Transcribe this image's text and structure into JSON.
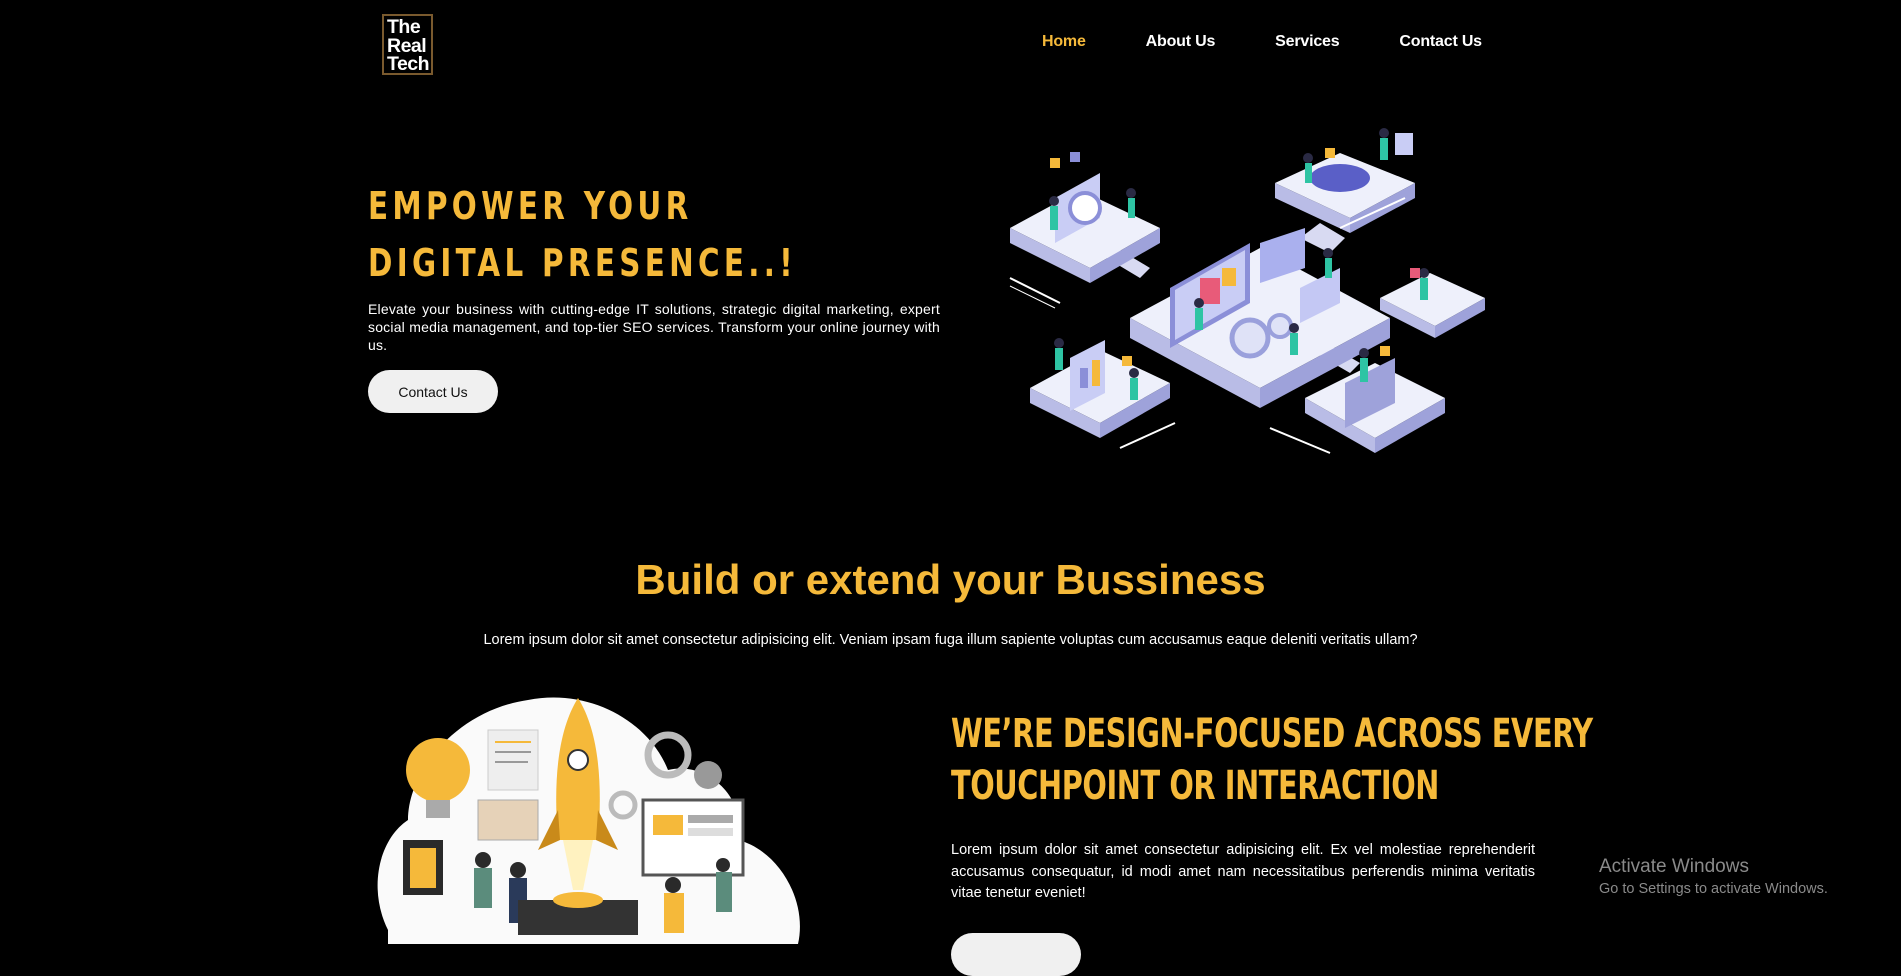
{
  "header": {
    "logo_lines": [
      "The",
      "Real",
      "Tech"
    ],
    "nav": [
      "Home",
      "About Us",
      "Services",
      "Contact Us"
    ],
    "active": "Home"
  },
  "hero": {
    "title": "EMPOWER YOUR DIGITAL PRESENCE..!",
    "text": "Elevate your business with cutting-edge IT solutions, strategic digital marketing, expert social media management, and top-tier SEO services. Transform your online journey with us.",
    "button": "Contact Us",
    "illustration": "isometric-it-platform-illustration"
  },
  "section": {
    "title": "Build or extend your Bussiness",
    "subtitle": "Lorem ipsum dolor sit amet consectetur adipisicing elit. Veniam ipsam fuga illum sapiente voluptas cum accusamus eaque deleniti veritatis ullam?",
    "illustration": "rocket-launch-team-illustration"
  },
  "design": {
    "title_line1": "WE’RE DESIGN-FOCUSED ACROSS EVERY",
    "title_line2": "TOUCHPOINT OR INTERACTION",
    "text": "Lorem ipsum dolor sit amet consectetur adipisicing elit. Ex vel molestiae reprehenderit accusamus consequatur, id modi amet nam necessitatibus perferendis minima veritatis vitae tenetur eveniet!"
  },
  "watermark": {
    "line1": "Activate Windows",
    "line2": "Go to Settings to activate Windows."
  },
  "colors": {
    "accent": "#f5b93a",
    "background": "#000000",
    "button": "#f0f0f0"
  }
}
